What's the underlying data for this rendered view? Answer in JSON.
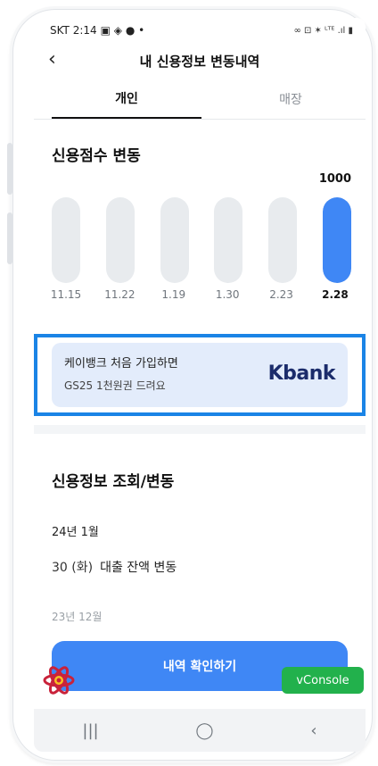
{
  "status_bar": {
    "carrier_time": "SKT 2:14",
    "left_icons": "▣ ◈ ●  •",
    "right_icons": "∞ ⊡ ✶ ᴸᵀᴱ .ıl ▮"
  },
  "appbar": {
    "back": "‹",
    "title": "내 신용정보 변동내역"
  },
  "tabs": [
    {
      "label": "개인"
    },
    {
      "label": "매장"
    }
  ],
  "score_section": {
    "title": "신용점수 변동"
  },
  "chart_data": {
    "type": "bar",
    "categories": [
      "11.15",
      "11.22",
      "1.19",
      "1.30",
      "2.23",
      "2.28"
    ],
    "values": [
      null,
      null,
      null,
      null,
      null,
      1000
    ],
    "highlight_label": "1000",
    "ylim": [
      0,
      1000
    ],
    "highlight_color": "#3f87f5",
    "track_color": "#e8ebee"
  },
  "banner": {
    "line1": "케이뱅크 처음 가입하면",
    "line2": "GS25 1천원권 드려요",
    "logo": "Kbank"
  },
  "credit_info": {
    "title": "신용정보 조회/변동",
    "month": "24년 1월",
    "entry_date": "30 (화)",
    "entry_text": "대출 잔액 변동",
    "next_month": "23년 12월"
  },
  "cta": {
    "label": "내역 확인하기"
  },
  "vconsole": {
    "label": "vConsole"
  },
  "navbar": {
    "recent": "|||",
    "home": "◯",
    "back": "‹"
  },
  "colors": {
    "accent": "#3f87f5",
    "banner_outline": "#1a84e6",
    "banner_bg": "#e3ecfb",
    "vconsole": "#22b14c"
  }
}
